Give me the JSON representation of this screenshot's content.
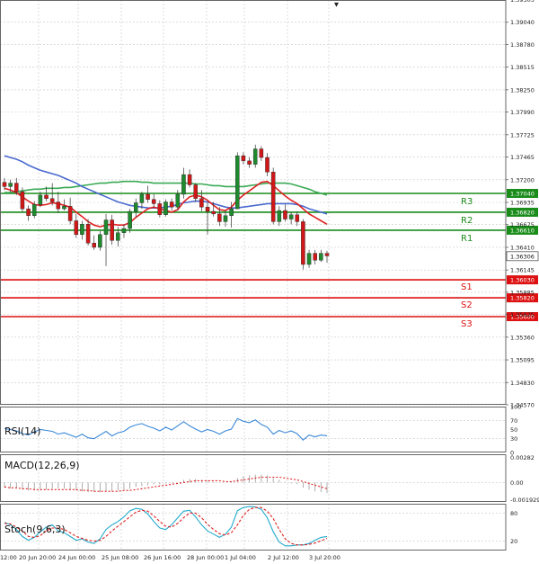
{
  "chart_data": {
    "type": "candlestick",
    "instrument_panels": [
      "price",
      "rsi",
      "macd",
      "stoch"
    ],
    "x_labels": [
      "12:00",
      "20 Jun 20:00",
      "24 Jun 00:00",
      "25 Jun 08:00",
      "26 Jun 16:00",
      "28 Jun 00:00",
      "1 Jul 04:00",
      "2 Jul 12:00",
      "3 Jul 20:00"
    ],
    "price_axis": {
      "ylim": [
        1.3457,
        1.393
      ],
      "ticks": [
        "1.39305",
        "1.39040",
        "1.38780",
        "1.38515",
        "1.38250",
        "1.37990",
        "1.37725",
        "1.37465",
        "1.37200",
        "1.36935",
        "1.36675",
        "1.36410",
        "1.36145",
        "1.35885",
        "1.35625",
        "1.35360",
        "1.35095",
        "1.34830",
        "1.34570"
      ],
      "current_price": "1.36306"
    },
    "levels": [
      {
        "name": "R3",
        "value": 1.3704,
        "label": "1.37040",
        "color": "#1a8c1a"
      },
      {
        "name": "R2",
        "value": 1.3682,
        "label": "1.36820",
        "color": "#1a8c1a"
      },
      {
        "name": "R1",
        "value": 1.3661,
        "label": "1.36610",
        "color": "#1a8c1a"
      },
      {
        "name": "S1",
        "value": 1.3603,
        "label": "1.36030",
        "color": "#dd1111"
      },
      {
        "name": "S2",
        "value": 1.3582,
        "label": "1.35820",
        "color": "#dd1111"
      },
      {
        "name": "S3",
        "value": 1.356,
        "label": "1.35600",
        "color": "#dd1111"
      }
    ],
    "candles": [
      [
        1.3717,
        1.3722,
        1.3708,
        1.3712
      ],
      [
        1.3712,
        1.372,
        1.3705,
        1.3716
      ],
      [
        1.3716,
        1.3722,
        1.3702,
        1.3706
      ],
      [
        1.3706,
        1.3711,
        1.3682,
        1.3686
      ],
      [
        1.3686,
        1.369,
        1.3672,
        1.3678
      ],
      [
        1.3678,
        1.3695,
        1.3675,
        1.3691
      ],
      [
        1.3691,
        1.3706,
        1.3688,
        1.3702
      ],
      [
        1.3702,
        1.3712,
        1.3695,
        1.3698
      ],
      [
        1.3698,
        1.3716,
        1.369,
        1.3694
      ],
      [
        1.3694,
        1.3706,
        1.3681,
        1.3686
      ],
      [
        1.3686,
        1.3697,
        1.3684,
        1.3689
      ],
      [
        1.3689,
        1.3699,
        1.3668,
        1.3672
      ],
      [
        1.3672,
        1.368,
        1.3652,
        1.3656
      ],
      [
        1.3656,
        1.3672,
        1.365,
        1.3668
      ],
      [
        1.3668,
        1.3674,
        1.3643,
        1.3646
      ],
      [
        1.3646,
        1.3655,
        1.3638,
        1.3641
      ],
      [
        1.3641,
        1.366,
        1.3637,
        1.3656
      ],
      [
        1.3656,
        1.368,
        1.3619,
        1.3673
      ],
      [
        1.3673,
        1.3679,
        1.3644,
        1.3649
      ],
      [
        1.3649,
        1.3665,
        1.3642,
        1.3658
      ],
      [
        1.3658,
        1.3668,
        1.3652,
        1.3663
      ],
      [
        1.3663,
        1.3686,
        1.3658,
        1.3683
      ],
      [
        1.3683,
        1.3698,
        1.3676,
        1.3693
      ],
      [
        1.3693,
        1.3706,
        1.3686,
        1.3703
      ],
      [
        1.3703,
        1.3713,
        1.3693,
        1.3697
      ],
      [
        1.3697,
        1.3703,
        1.3688,
        1.3692
      ],
      [
        1.3692,
        1.3696,
        1.3676,
        1.3679
      ],
      [
        1.3679,
        1.3697,
        1.3677,
        1.3694
      ],
      [
        1.3694,
        1.3698,
        1.3684,
        1.3688
      ],
      [
        1.3688,
        1.3708,
        1.3684,
        1.3703
      ],
      [
        1.3703,
        1.3734,
        1.3698,
        1.3726
      ],
      [
        1.3726,
        1.3732,
        1.3711,
        1.3714
      ],
      [
        1.3714,
        1.3716,
        1.3694,
        1.3698
      ],
      [
        1.3698,
        1.3708,
        1.3683,
        1.3688
      ],
      [
        1.3688,
        1.3694,
        1.3656,
        1.3683
      ],
      [
        1.3683,
        1.3694,
        1.3677,
        1.368
      ],
      [
        1.368,
        1.3688,
        1.3666,
        1.3671
      ],
      [
        1.3671,
        1.3684,
        1.3665,
        1.3678
      ],
      [
        1.3678,
        1.3694,
        1.3664,
        1.3686
      ],
      [
        1.3686,
        1.3752,
        1.3686,
        1.3748
      ],
      [
        1.3748,
        1.3752,
        1.3738,
        1.3742
      ],
      [
        1.3742,
        1.3746,
        1.3734,
        1.3738
      ],
      [
        1.3738,
        1.3761,
        1.3734,
        1.3756
      ],
      [
        1.3756,
        1.3759,
        1.3742,
        1.3746
      ],
      [
        1.3746,
        1.3751,
        1.3724,
        1.3729
      ],
      [
        1.3729,
        1.3734,
        1.3668,
        1.3671
      ],
      [
        1.3671,
        1.3689,
        1.3666,
        1.3684
      ],
      [
        1.3684,
        1.3691,
        1.3671,
        1.3674
      ],
      [
        1.3674,
        1.3682,
        1.3668,
        1.3679
      ],
      [
        1.3679,
        1.3683,
        1.3666,
        1.3671
      ],
      [
        1.3671,
        1.3674,
        1.3615,
        1.3621
      ],
      [
        1.3621,
        1.3638,
        1.3617,
        1.3634
      ],
      [
        1.3634,
        1.3638,
        1.3621,
        1.3626
      ],
      [
        1.3626,
        1.3638,
        1.3624,
        1.3634
      ],
      [
        1.3634,
        1.3637,
        1.3623,
        1.3631
      ]
    ],
    "ma_red": [
      1.371,
      1.3708,
      1.3705,
      1.37,
      1.3695,
      1.3691,
      1.369,
      1.3691,
      1.3693,
      1.3692,
      1.369,
      1.3688,
      1.3682,
      1.3677,
      1.3671,
      1.3667,
      1.3665,
      1.3667,
      1.3668,
      1.3667,
      1.3667,
      1.367,
      1.3676,
      1.3681,
      1.3686,
      1.3688,
      1.3686,
      1.3684,
      1.3682,
      1.3685,
      1.3694,
      1.37,
      1.3702,
      1.37,
      1.3696,
      1.369,
      1.3685,
      1.3684,
      1.3688,
      1.3696,
      1.3702,
      1.3707,
      1.3712,
      1.3717,
      1.3718,
      1.3713,
      1.3707,
      1.3701,
      1.3696,
      1.3692,
      1.3686,
      1.368,
      1.3676,
      1.3672,
      1.3668
    ],
    "ma_blue": [
      1.3748,
      1.3746,
      1.3744,
      1.3741,
      1.3737,
      1.3734,
      1.3731,
      1.3729,
      1.3727,
      1.3725,
      1.3722,
      1.3719,
      1.3716,
      1.3712,
      1.3709,
      1.3706,
      1.3703,
      1.37,
      1.3697,
      1.3694,
      1.3692,
      1.369,
      1.3689,
      1.3688,
      1.3687,
      1.3687,
      1.3687,
      1.3688,
      1.3689,
      1.3691,
      1.3693,
      1.3694,
      1.3695,
      1.3695,
      1.3694,
      1.3692,
      1.369,
      1.3688,
      1.3687,
      1.3687,
      1.3688,
      1.3689,
      1.369,
      1.3691,
      1.3692,
      1.3692,
      1.3692,
      1.3692,
      1.3692,
      1.3691,
      1.3689,
      1.3686,
      1.3684,
      1.3682,
      1.368
    ],
    "ma_green": [
      1.3705,
      1.3705,
      1.3706,
      1.3707,
      1.3708,
      1.3709,
      1.3709,
      1.371,
      1.371,
      1.371,
      1.3711,
      1.3711,
      1.3712,
      1.3713,
      1.3714,
      1.3715,
      1.3716,
      1.3716,
      1.3717,
      1.3717,
      1.3718,
      1.3718,
      1.3718,
      1.3717,
      1.3717,
      1.3716,
      1.3716,
      1.3716,
      1.3716,
      1.3716,
      1.3716,
      1.3716,
      1.3715,
      1.3715,
      1.3714,
      1.3713,
      1.3713,
      1.3712,
      1.3712,
      1.3712,
      1.3712,
      1.3713,
      1.3714,
      1.3715,
      1.3716,
      1.3716,
      1.3716,
      1.3716,
      1.3715,
      1.3713,
      1.3711,
      1.3709,
      1.3706,
      1.3704,
      1.3702
    ],
    "rsi": {
      "label": "RSI(14)",
      "ylim": [
        0,
        100
      ],
      "ticks": [
        "100",
        "70",
        "50",
        "30",
        "0"
      ],
      "values": [
        52,
        50,
        47,
        41,
        38,
        45,
        50,
        48,
        46,
        40,
        43,
        38,
        33,
        40,
        32,
        30,
        38,
        46,
        36,
        43,
        46,
        55,
        60,
        63,
        57,
        53,
        47,
        55,
        49,
        58,
        67,
        58,
        51,
        45,
        50,
        46,
        40,
        47,
        51,
        74,
        68,
        65,
        71,
        61,
        55,
        40,
        48,
        43,
        47,
        41,
        27,
        38,
        34,
        38,
        36
      ]
    },
    "macd": {
      "label": "MACD(12,26,9)",
      "ylim": [
        -0.0022,
        0.0032
      ],
      "ticks": [
        "0.00282",
        "0.00",
        "-0.001929"
      ],
      "hist": [
        -0.0006,
        -0.0007,
        -0.0007,
        -0.0008,
        -0.0009,
        -0.0009,
        -0.0008,
        -0.0008,
        -0.0007,
        -0.0007,
        -0.0007,
        -0.0008,
        -0.0009,
        -0.001,
        -0.0011,
        -0.0011,
        -0.0011,
        -0.001,
        -0.001,
        -0.0009,
        -0.0008,
        -0.0007,
        -0.0005,
        -0.0004,
        -0.0003,
        -0.0002,
        -0.0002,
        -0.0001,
        -0.0001,
        0.0,
        0.0003,
        0.0004,
        0.0004,
        0.0003,
        0.0002,
        0.0001,
        0.0,
        0.0,
        0.0001,
        0.0005,
        0.0007,
        0.0008,
        0.0009,
        0.0009,
        0.0008,
        0.0005,
        0.0003,
        0.0001,
        -0.0001,
        -0.0002,
        -0.0006,
        -0.0008,
        -0.001,
        -0.0011,
        -0.0012
      ],
      "signal": [
        -0.0005,
        -0.0006,
        -0.0006,
        -0.0007,
        -0.0007,
        -0.0008,
        -0.0008,
        -0.0008,
        -0.0008,
        -0.0008,
        -0.0008,
        -0.0008,
        -0.0008,
        -0.0009,
        -0.0009,
        -0.001,
        -0.001,
        -0.001,
        -0.001,
        -0.001,
        -0.0009,
        -0.0009,
        -0.0008,
        -0.0007,
        -0.0006,
        -0.0005,
        -0.0004,
        -0.0003,
        -0.0002,
        -0.0001,
        0.0,
        0.0001,
        0.0002,
        0.0002,
        0.0002,
        0.0002,
        0.0002,
        0.0001,
        0.0001,
        0.0002,
        0.0003,
        0.0004,
        0.0005,
        0.0006,
        0.0006,
        0.0006,
        0.0006,
        0.0005,
        0.0004,
        0.0003,
        0.0001,
        -0.0001,
        -0.0003,
        -0.0005,
        -0.0007
      ]
    },
    "stoch": {
      "label": "Stoch(9,6,3)",
      "ylim": [
        0,
        100
      ],
      "ticks": [
        "80",
        "20"
      ],
      "k": [
        60,
        55,
        45,
        30,
        22,
        28,
        40,
        50,
        55,
        42,
        38,
        30,
        22,
        25,
        18,
        15,
        25,
        45,
        55,
        62,
        72,
        85,
        90,
        88,
        78,
        62,
        48,
        45,
        55,
        70,
        84,
        86,
        72,
        55,
        42,
        35,
        28,
        35,
        50,
        85,
        92,
        94,
        93,
        88,
        70,
        40,
        18,
        10,
        10,
        12,
        12,
        15,
        22,
        28,
        30
      ],
      "d": [
        58,
        57,
        50,
        42,
        30,
        28,
        32,
        42,
        48,
        48,
        45,
        38,
        30,
        26,
        22,
        20,
        22,
        30,
        42,
        52,
        62,
        72,
        82,
        86,
        84,
        74,
        62,
        52,
        50,
        58,
        70,
        80,
        80,
        70,
        56,
        45,
        36,
        33,
        38,
        55,
        75,
        88,
        92,
        92,
        84,
        68,
        45,
        25,
        15,
        12,
        12,
        13,
        16,
        21,
        26
      ]
    }
  }
}
